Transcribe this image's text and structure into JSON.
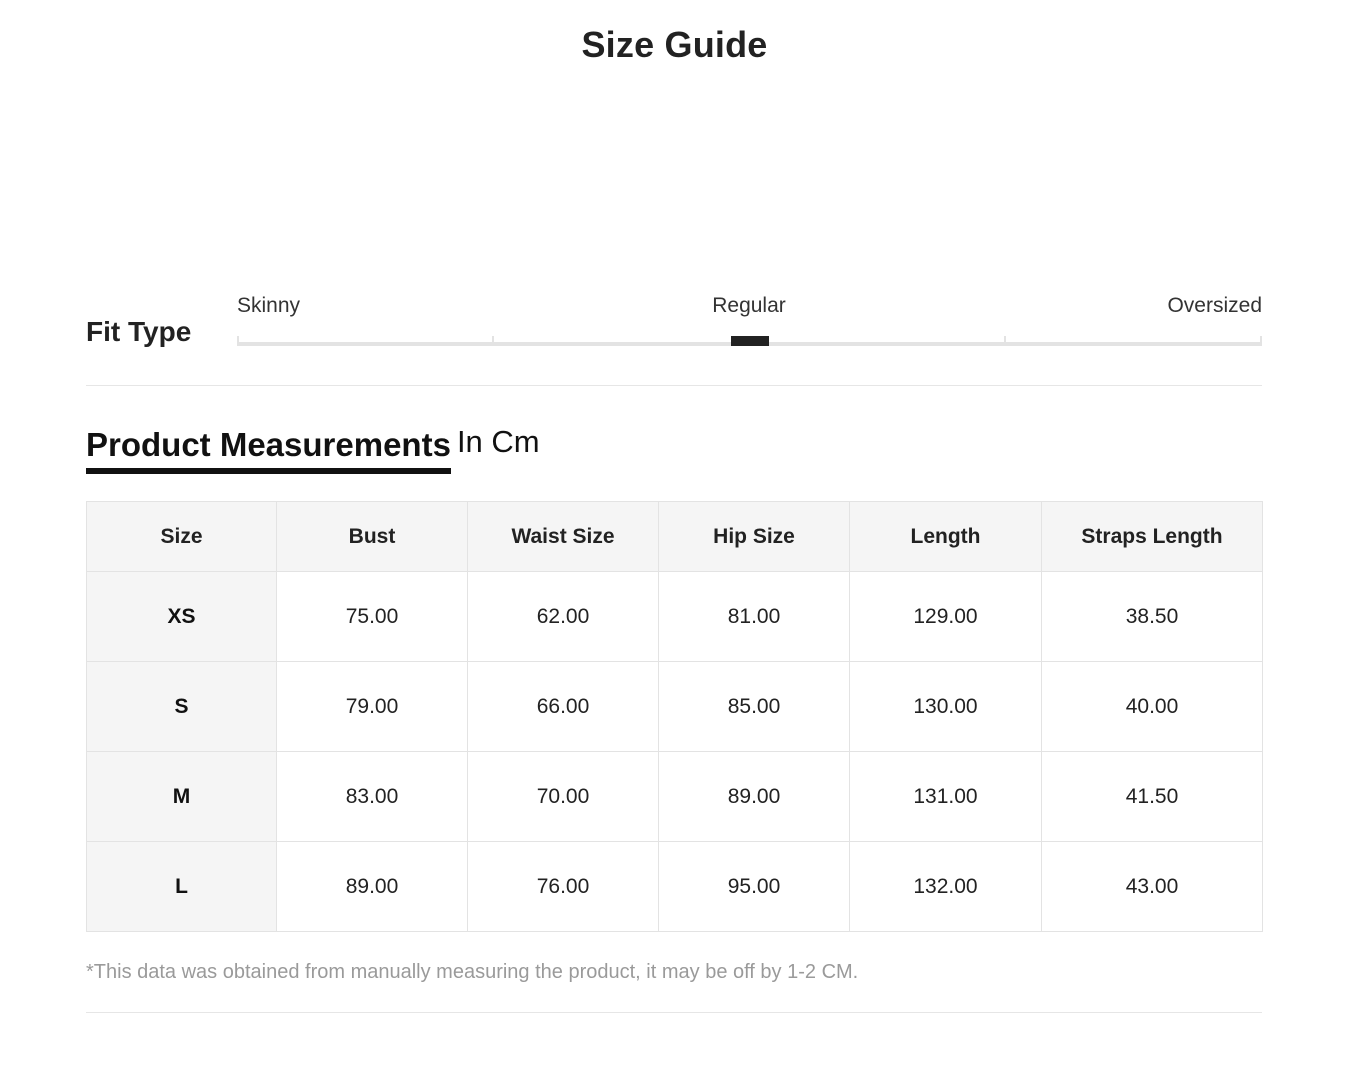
{
  "page": {
    "title": "Size Guide"
  },
  "fit_type": {
    "title": "Fit Type",
    "labels": {
      "skinny": "Skinny",
      "regular": "Regular",
      "oversized": "Oversized"
    },
    "selected": "Regular",
    "selected_position_fraction": 0.5
  },
  "measurements": {
    "title": "Product Measurements",
    "unit": "In Cm",
    "headers": [
      "Size",
      "Bust",
      "Waist Size",
      "Hip Size",
      "Length",
      "Straps Length"
    ],
    "rows": [
      [
        "XS",
        "75.00",
        "62.00",
        "81.00",
        "129.00",
        "38.50"
      ],
      [
        "S",
        "79.00",
        "66.00",
        "85.00",
        "130.00",
        "40.00"
      ],
      [
        "M",
        "83.00",
        "70.00",
        "89.00",
        "131.00",
        "41.50"
      ],
      [
        "L",
        "89.00",
        "76.00",
        "95.00",
        "132.00",
        "43.00"
      ]
    ]
  },
  "disclaimer": "*This data was obtained from manually measuring the product, it may be off by 1-2 CM.",
  "colors": {
    "text": "#222222",
    "marker": "#222222",
    "track": "#e3e3e3",
    "header_bg": "#f5f5f5",
    "muted": "#9a9a9a"
  }
}
